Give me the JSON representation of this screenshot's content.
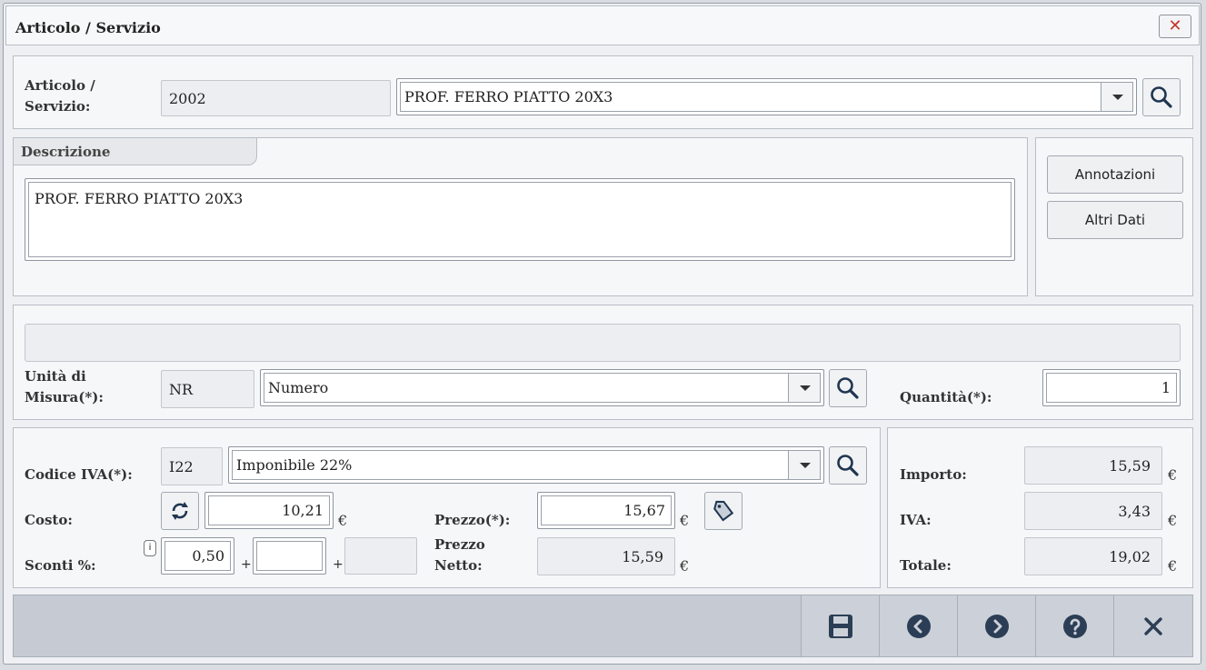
{
  "window": {
    "title": "Articolo / Servizio"
  },
  "article": {
    "label_line1": "Articolo /",
    "label_line2": "Servizio:",
    "code": "2002",
    "name": "PROF. FERRO PIATTO 20X3"
  },
  "description": {
    "tab_label": "Descrizione",
    "text": "PROF. FERRO PIATTO 20X3"
  },
  "side_buttons": {
    "annotations": "Annotazioni",
    "other_data": "Altri Dati"
  },
  "unit": {
    "label_line1": "Unità di",
    "label_line2": "Misura(*):",
    "code": "NR",
    "name": "Numero"
  },
  "quantity": {
    "label": "Quantità(*):",
    "value": "1"
  },
  "vat": {
    "label": "Codice IVA(*):",
    "code": "I22",
    "name": "Imponibile 22%"
  },
  "cost": {
    "label": "Costo:",
    "value": "10,21"
  },
  "price": {
    "label": "Prezzo(*):",
    "value": "15,67"
  },
  "discounts": {
    "label": "Sconti %:",
    "d1": "0,50",
    "d2": "",
    "d3": "",
    "info": "i",
    "plus": "+"
  },
  "net_price": {
    "label_line1": "Prezzo",
    "label_line2": "Netto:",
    "value": "15,59"
  },
  "totals": {
    "amount_label": "Importo:",
    "amount": "15,59",
    "vat_label": "IVA:",
    "vat": "3,43",
    "total_label": "Totale:",
    "total": "19,02"
  },
  "currency": "€",
  "icons": {
    "close": "close-icon",
    "search": "search-icon",
    "refresh": "refresh-icon",
    "tag": "tag-icon",
    "save": "save-icon",
    "prev": "chevron-left-icon",
    "next": "chevron-right-icon",
    "help": "help-icon",
    "exit": "close-icon"
  }
}
